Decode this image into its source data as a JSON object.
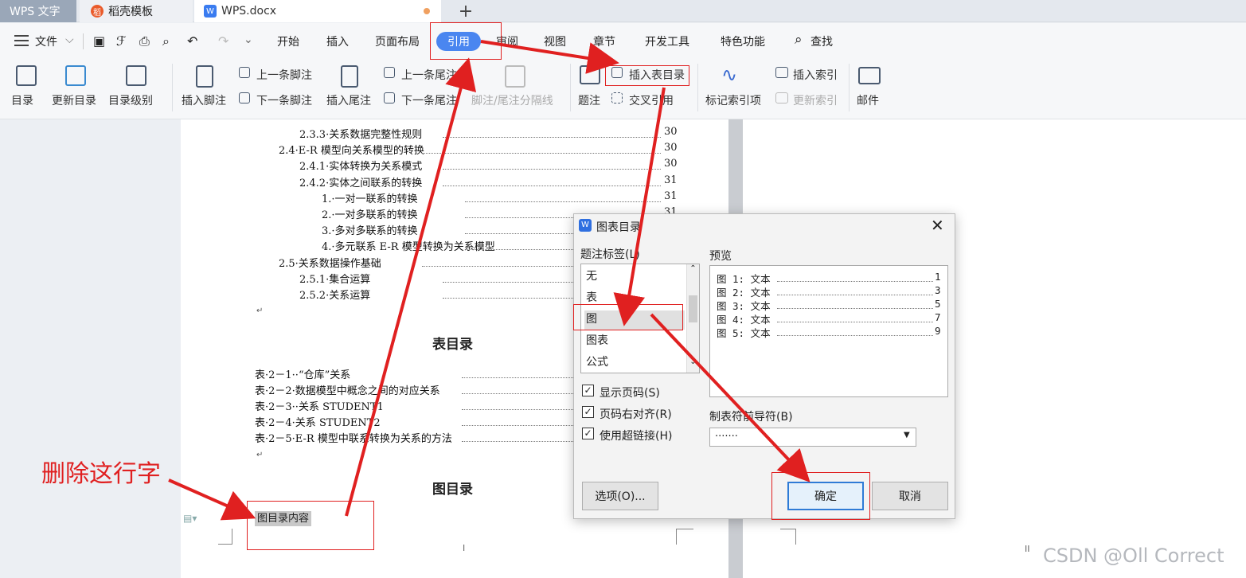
{
  "tabs": {
    "app": "WPS 文字",
    "template": "稻壳模板",
    "doc": "WPS.docx",
    "new": "+"
  },
  "menu": {
    "file": "文件",
    "items": [
      "开始",
      "插入",
      "页面布局",
      "引用",
      "审阅",
      "视图",
      "章节",
      "开发工具",
      "特色功能"
    ],
    "search": "查找"
  },
  "ribbon": {
    "toc": "目录",
    "update_toc": "更新目录",
    "toc_level": "目录级别",
    "insert_footnote": "插入脚注",
    "prev_footnote": "上一条脚注",
    "next_footnote": "下一条脚注",
    "insert_endnote": "插入尾注",
    "prev_endnote": "上一条尾注",
    "next_endnote": "下一条尾注",
    "separator": "脚注/尾注分隔线",
    "caption": "题注",
    "insert_toc_figure": "插入表目录",
    "cross_ref": "交叉引用",
    "mark_index": "标记索引项",
    "insert_index": "插入索引",
    "update_index": "更新索引",
    "mail": "邮件"
  },
  "document": {
    "toc_lines": [
      {
        "text": "2.3.3·关系数据完整性规则",
        "page": "30"
      },
      {
        "text": "2.4·E-R 模型向关系模型的转换",
        "page": "30"
      },
      {
        "text": "2.4.1·实体转换为关系模式",
        "page": "30"
      },
      {
        "text": "2.4.2·实体之间联系的转换",
        "page": "31"
      },
      {
        "text": "1.·一对一联系的转换",
        "page": "31"
      },
      {
        "text": "2.·一对多联系的转换",
        "page": "31"
      },
      {
        "text": "3.·多对多联系的转换",
        "page": ""
      },
      {
        "text": "4.·多元联系 E-R 模型转换为关系模型",
        "page": ""
      },
      {
        "text": "2.5·关系数据操作基础",
        "page": ""
      },
      {
        "text": "2.5.1·集合运算",
        "page": ""
      },
      {
        "text": "2.5.2·关系运算",
        "page": ""
      }
    ],
    "table_heading": "表目录",
    "table_lines": [
      "表·2－1··“仓库”关系",
      "表·2－2·数据模型中概念之间的对应关系",
      "表·2－3··关系 STUDENT1",
      "表·2－4·关系 STUDENT2",
      "表·2－5·E-R 模型中联系转换为关系的方法"
    ],
    "figure_heading": "图目录",
    "figure_placeholder": "图目录内容",
    "page_mark": "II"
  },
  "dialog": {
    "title": "图表目录",
    "caption_label": "题注标签(L)",
    "captions": [
      "无",
      "表",
      "图",
      "图表",
      "公式"
    ],
    "selected": "图",
    "preview_label": "预览",
    "preview": [
      {
        "text": "图 1: 文本",
        "page": "1"
      },
      {
        "text": "图 2: 文本",
        "page": "3"
      },
      {
        "text": "图 3: 文本",
        "page": "5"
      },
      {
        "text": "图 4: 文本",
        "page": "7"
      },
      {
        "text": "图 5: 文本",
        "page": "9"
      }
    ],
    "show_page": "显示页码(S)",
    "right_align": "页码右对齐(R)",
    "hyperlink": "使用超链接(H)",
    "leader_label": "制表符前导符(B)",
    "leader_value": "·······",
    "options": "选项(O)...",
    "ok": "确定",
    "cancel": "取消"
  },
  "annotation": {
    "text": "删除这行字",
    "color": "#e02020"
  },
  "watermark": "CSDN @Oll Correct"
}
